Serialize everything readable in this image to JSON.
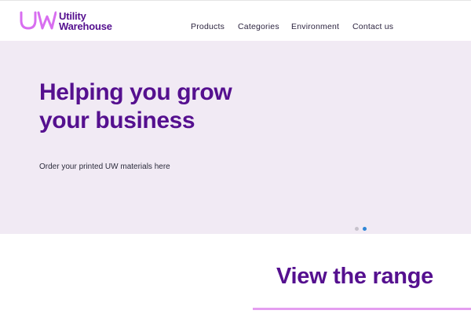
{
  "brand": {
    "line1": "Utility",
    "line2": "Warehouse",
    "logo_icon": "uw-logo-icon",
    "color": "#55108f"
  },
  "nav": {
    "items": [
      {
        "label": "Products"
      },
      {
        "label": "Categories"
      },
      {
        "label": "Environment"
      },
      {
        "label": "Contact us"
      }
    ]
  },
  "hero": {
    "title_line1": "Helping you grow",
    "title_line2": "your business",
    "subtitle": "Order your printed UW materials here",
    "background": "#f1eaf4",
    "carousel": {
      "slides": 2,
      "active_slide": 2,
      "active_color": "#2f86d6"
    }
  },
  "range": {
    "title": "View the range",
    "accent": "#e49ef0"
  }
}
